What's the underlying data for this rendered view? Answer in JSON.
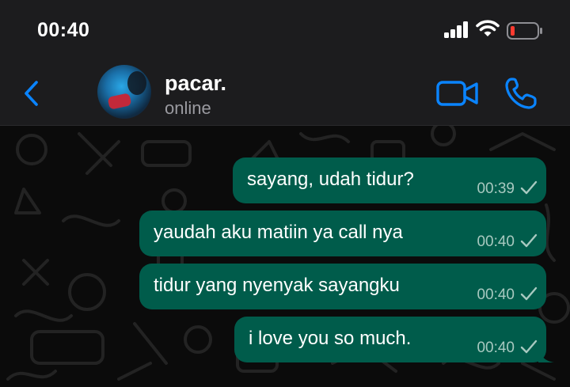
{
  "status_bar": {
    "time": "00:40"
  },
  "header": {
    "contact_name": "pacar.",
    "contact_status": "online"
  },
  "messages": [
    {
      "text": "sayang, udah tidur?",
      "time": "00:39"
    },
    {
      "text": "yaudah aku matiin ya call nya",
      "time": "00:40"
    },
    {
      "text": "tidur yang nyenyak sayangku",
      "time": "00:40"
    },
    {
      "text": "i love you so much.",
      "time": "00:40"
    }
  ],
  "colors": {
    "accent": "#0a84ff",
    "outgoing_bubble": "#005c4b",
    "header_bg": "#1c1c1e",
    "chat_bg": "#0b0b0b",
    "battery_low": "#ff3b30"
  },
  "icons": {
    "back": "chevron-left-icon",
    "video": "video-camera-icon",
    "call": "phone-icon",
    "tick": "checkmark-icon"
  }
}
